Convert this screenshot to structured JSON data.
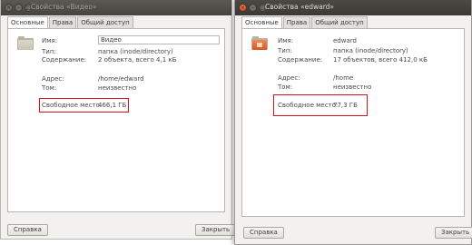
{
  "left_window": {
    "title": "Свойства «Видео»",
    "tabs": [
      "Основные",
      "Права",
      "Общий доступ"
    ],
    "fields": {
      "name_label": "Имя:",
      "name_value": "Видео",
      "type_label": "Тип:",
      "type_value": "папка (inode/directory)",
      "contents_label": "Содержание:",
      "contents_value": "2 объекта, всего 4,1 кБ",
      "location_label": "Адрес:",
      "location_value": "/home/edward",
      "volume_label": "Том:",
      "volume_value": "неизвестно",
      "free_label": "Свободное место:",
      "free_value": "466,1 ГБ"
    },
    "help_label": "Справка",
    "close_label": "Закрыть"
  },
  "right_window": {
    "title": "Свойства «edward»",
    "tabs": [
      "Основные",
      "Права",
      "Общий доступ"
    ],
    "fields": {
      "name_label": "Имя:",
      "name_value": "edward",
      "type_label": "Тип:",
      "type_value": "папка (inode/directory)",
      "contents_label": "Содержание:",
      "contents_value": "17 объектов, всего 412,0 кБ",
      "location_label": "Адрес:",
      "location_value": "/home",
      "volume_label": "Том:",
      "volume_value": "неизвестно",
      "free_label": "Свободное место:",
      "free_value": "77,3 ГБ"
    },
    "help_label": "Справка",
    "close_label": "Закрыть"
  },
  "window_buttons": {
    "close": "×",
    "minimize": "–",
    "maximize": "□"
  },
  "colors": {
    "highlight": "#e0101a",
    "titlebar": "#3a3935",
    "orange": "#dc4a16"
  }
}
